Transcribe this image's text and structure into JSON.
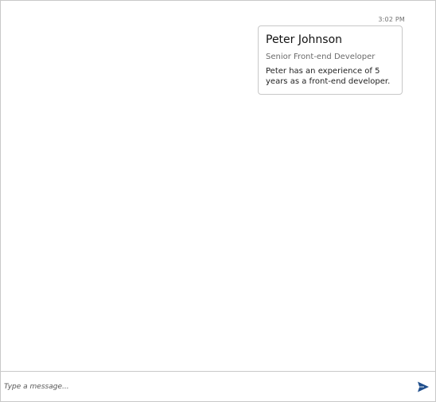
{
  "message": {
    "timestamp": "3:02 PM",
    "card": {
      "title": "Peter Johnson",
      "subtitle": "Senior Front-end Developer",
      "text": "Peter has an experience of 5 years as a front-end developer."
    }
  },
  "composer": {
    "placeholder": "Type a message...",
    "send_icon": "send-icon",
    "accent_color": "#1f4e8c"
  }
}
